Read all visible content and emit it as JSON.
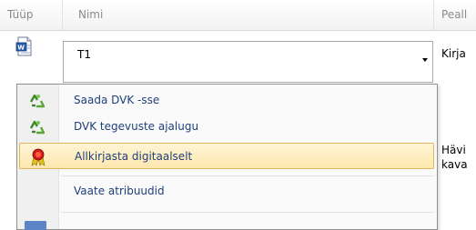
{
  "columns": {
    "type_label": "Tüüp",
    "name_label": "Nimi",
    "title_label": "Peall"
  },
  "row": {
    "icon": "word-document-icon",
    "name_value": "T1",
    "title_value": "Kirja"
  },
  "right_text": {
    "line1": "Hävi",
    "line2": "kava"
  },
  "context_menu": {
    "items": [
      {
        "label": "Saada DVK -sse",
        "icon": "recycle-arrows-icon"
      },
      {
        "label": "DVK tegevuste ajalugu",
        "icon": "recycle-arrows-icon"
      },
      {
        "label": "Allkirjasta digitaalselt",
        "icon": "ribbon-award-icon"
      },
      {
        "label": "Vaate atribuudid"
      }
    ]
  },
  "colors": {
    "menu_text": "#1f3f7a",
    "highlight_bg": "#fde7ad",
    "highlight_border": "#e3b560"
  }
}
